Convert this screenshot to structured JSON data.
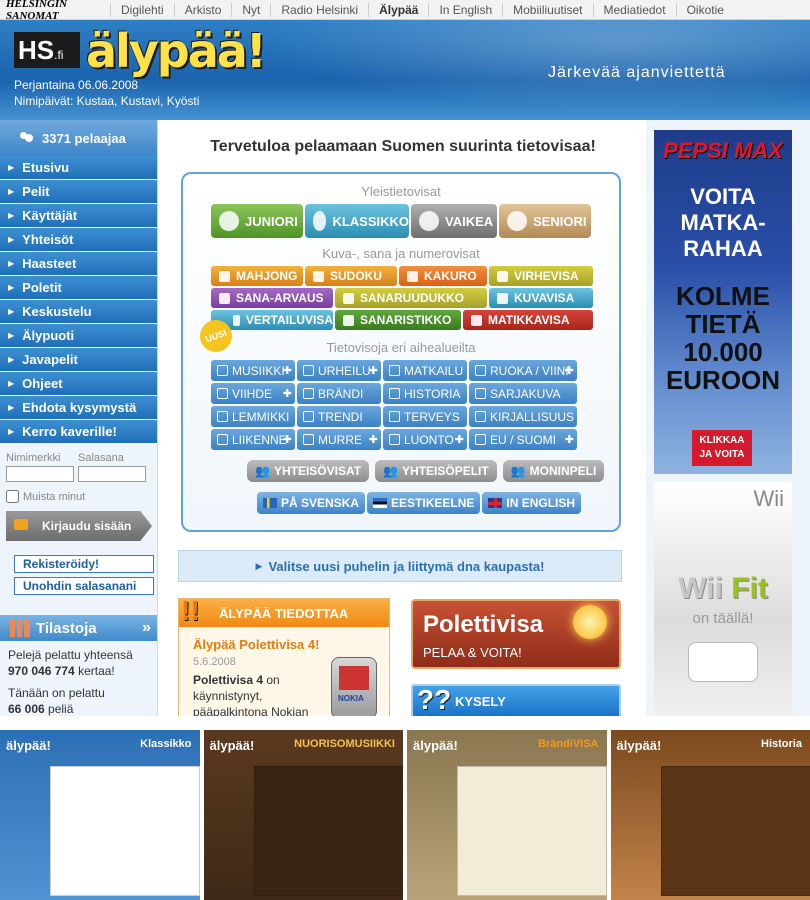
{
  "topbar": {
    "logo": "HELSINGIN SANOMAT",
    "links": [
      "Digilehti",
      "Arkisto",
      "Nyt",
      "Radio Helsinki",
      "Älypää",
      "In English",
      "Mobiiliuutiset",
      "Mediatiedot",
      "Oikotie"
    ]
  },
  "header": {
    "hs_logo": "HS",
    "hs_logo_suffix": ".fi",
    "logo": "älypää!",
    "date": "Perjantaina 06.06.2008",
    "names": "Nimipäivät: Kustaa, Kustavi, Kyösti",
    "tagline": "Järkevää ajanviettettä"
  },
  "sidebar": {
    "users": "3371 pelaajaa",
    "nav": [
      "Etusivu",
      "Pelit",
      "Käyttäjät",
      "Yhteisöt",
      "Haasteet",
      "Poletit",
      "Keskustelu",
      "Älypuoti",
      "Javapelit",
      "Ohjeet",
      "Ehdota kysymystä",
      "Kerro kaverille!"
    ],
    "login": {
      "username_label": "Nimimerkki",
      "password_label": "Salasana",
      "remember_label": "Muista minut",
      "login_button": "Kirjaudu sisään",
      "register_button": "Rekisteröidy!",
      "forgot_button": "Unohdin salasanani"
    },
    "stats": {
      "title": "Tilastoja",
      "more": "»",
      "line1": "Pelejä pelattu yhteensä",
      "total": "970 046 774",
      "total_suffix": " kertaa!",
      "line2": "Tänään on pelattu",
      "today": "66 006",
      "today_suffix": " peliä"
    }
  },
  "main": {
    "welcome": "Tervetuloa pelaamaan Suomen suurinta tietovisaa!",
    "general": {
      "title": "Yleistietovisat",
      "buttons": [
        "JUNIORI",
        "KLASSIKKO",
        "VAIKEA",
        "SENIORI"
      ]
    },
    "picture": {
      "title": "Kuva-, sana ja numerovisat",
      "badge": "UUSI",
      "buttons": [
        "MAHJONG",
        "SUDOKU",
        "KAKURO",
        "VIRHEVISA",
        "SANA-ARVAUS",
        "SANARUUDUKKO",
        "KUVAVISA",
        "VERTAILUVISA",
        "SANARISTIKKO",
        "MATIKKAVISA"
      ]
    },
    "topics": {
      "title": "Tietovisoja eri aihealueilta",
      "buttons": [
        "MUSIIKKI",
        "URHEILU",
        "MATKAILU",
        "RUOKA / VIINI",
        "VIIHDE",
        "BRÄNDI",
        "HISTORIA",
        "SARJAKUVA",
        "LEMMIKKI",
        "TRENDI",
        "TERVEYS",
        "KIRJALLISUUS",
        "LIIKENNE",
        "MURRE",
        "LUONTO",
        "EU / SUOMI"
      ]
    },
    "community": [
      "YHTEISÖVISAT",
      "YHTEISÖPELIT",
      "MONINPELI"
    ],
    "languages": [
      "PÅ SVENSKA",
      "EESTIKEELNE",
      "IN ENGLISH"
    ],
    "dna_banner": "Valitse uusi puhelin ja liittymä dna kaupasta!",
    "news": {
      "head": "ÄLYPÄÄ TIEDOTTAA",
      "title": "Älypää Polettivisa 4!",
      "date": "5.6.2008",
      "body_bold": "Polettivisa 4",
      "body": " on käynnistynyt, pääpalkintona Nokian",
      "phone_brand": "NOKIA"
    },
    "polettivisa": {
      "title": "Polettivisa",
      "subtitle": "PELAA & VOITA!"
    },
    "kysely": "KYSELY"
  },
  "ads": {
    "pepsi_brand": "PEPSI MAX",
    "pepsi_l1": "VOITA",
    "pepsi_l2": "MATKA-",
    "pepsi_l3": "RAHAA",
    "pepsi_l4": "KOLME",
    "pepsi_l5": "TIETÄ",
    "pepsi_l6": "10.000",
    "pepsi_l7": "EUROON",
    "pepsi_cta": "KLIKKAA JA VOITA",
    "wii_brand": "Wii",
    "wii_fit_a": "Wii",
    "wii_fit_b": "Fit",
    "wii_tag": "on täällä!"
  },
  "thumbnails": [
    {
      "logo": "älypää!",
      "title": "Klassikko"
    },
    {
      "logo": "älypää!",
      "title": "NUORISOMUSIIKKI"
    },
    {
      "logo": "älypää!",
      "title": "BrändiVISA"
    },
    {
      "logo": "älypää!",
      "title": "Historia"
    }
  ],
  "colors": {
    "header_blue": "#1a63ad",
    "nav_blue": "#2877bf",
    "orange": "#f08a13",
    "green": "#5aa02c",
    "teal": "#3ea0c4",
    "gray": "#8b8b8b",
    "tan": "#c7a878"
  }
}
